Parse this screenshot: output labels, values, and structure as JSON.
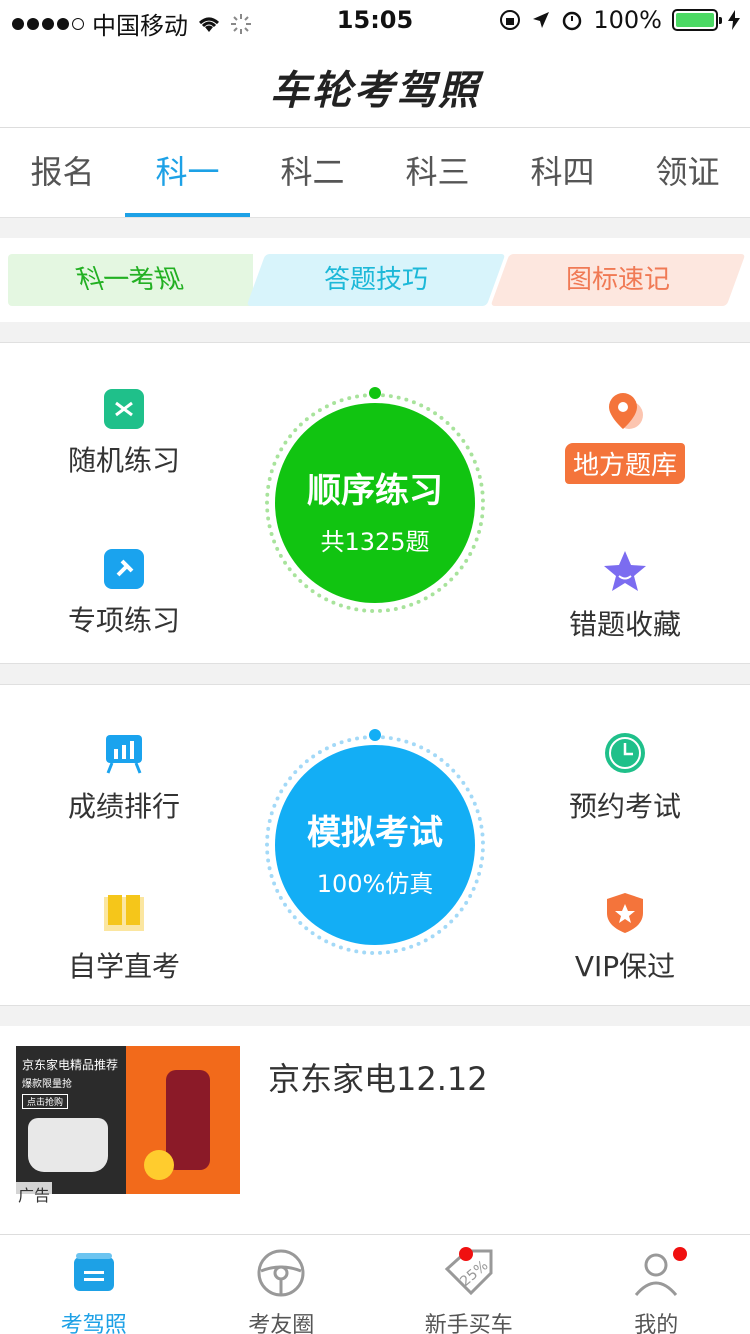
{
  "status_bar": {
    "carrier": "中国移动",
    "time": "15:05",
    "battery_percent": "100%"
  },
  "header": {
    "title": "车轮考驾照"
  },
  "tabs": [
    {
      "label": "报名",
      "active": false
    },
    {
      "label": "科一",
      "active": true
    },
    {
      "label": "科二",
      "active": false
    },
    {
      "label": "科三",
      "active": false
    },
    {
      "label": "科四",
      "active": false
    },
    {
      "label": "领证",
      "active": false
    }
  ],
  "quick_links": [
    {
      "label": "科一考规",
      "color": "#22b022"
    },
    {
      "label": "答题技巧",
      "color": "#1cb8d8"
    },
    {
      "label": "图标速记",
      "color": "#f07a55"
    }
  ],
  "practice": {
    "main_title": "顺序练习",
    "main_sub": "共1325题",
    "main_color": "#11c411",
    "random": "随机练习",
    "special": "专项练习",
    "regional": "地方题库",
    "mistakes": "错题收藏"
  },
  "exam": {
    "main_title": "模拟考试",
    "main_sub": "100%仿真",
    "main_color": "#13aef5",
    "ranking": "成绩排行",
    "self_study": "自学直考",
    "appointment": "预约考试",
    "vip": "VIP保过"
  },
  "ad": {
    "title": "京东家电12.12",
    "tag": "广告",
    "image_text_1": "京东家电精品推荐",
    "image_text_2": "爆款限量抢",
    "image_text_3": "点击抢购"
  },
  "tab_bar": [
    {
      "label": "考驾照",
      "icon": "license-icon",
      "active": true
    },
    {
      "label": "考友圈",
      "icon": "steering-wheel-icon",
      "active": false
    },
    {
      "label": "新手买车",
      "icon": "discount-tag-icon",
      "active": false,
      "badge_text": "25%"
    },
    {
      "label": "我的",
      "icon": "profile-icon",
      "active": false
    }
  ]
}
